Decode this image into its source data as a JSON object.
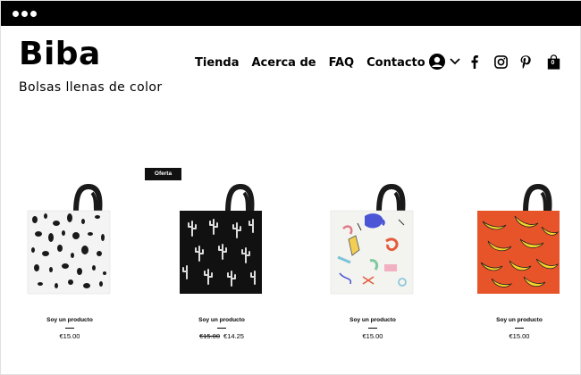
{
  "window": {
    "dots": [
      "dot",
      "dot",
      "dot"
    ]
  },
  "header": {
    "brand": "Biba",
    "tagline": "Bolsas llenas de color",
    "nav": [
      {
        "label": "Tienda"
      },
      {
        "label": "Acerca de"
      },
      {
        "label": "FAQ"
      },
      {
        "label": "Contacto"
      }
    ],
    "icons": {
      "account": "user-icon",
      "dropdown": "chevron-down-icon",
      "facebook": "facebook-icon",
      "instagram": "instagram-icon",
      "pinterest": "pinterest-icon",
      "cart": "shopping-bag-icon"
    },
    "cart_count": "0"
  },
  "sale_badge": "Oferta",
  "products": [
    {
      "name": "Soy un producto",
      "price": "€15.00",
      "pattern": "spots",
      "bg": "#f4f4f4",
      "accent": "#1a1a1a"
    },
    {
      "name": "Soy un producto",
      "old_price": "€15.00",
      "price": "€14.25",
      "pattern": "cactus",
      "bg": "#111111",
      "accent": "#dddddd"
    },
    {
      "name": "Soy un producto",
      "price": "€15.00",
      "pattern": "paint",
      "bg": "#f3f3ef",
      "accent": "#4b55d6"
    },
    {
      "name": "Soy un producto",
      "price": "€15.00",
      "pattern": "banana",
      "bg": "#e8542a",
      "accent": "#f6d42a"
    }
  ]
}
